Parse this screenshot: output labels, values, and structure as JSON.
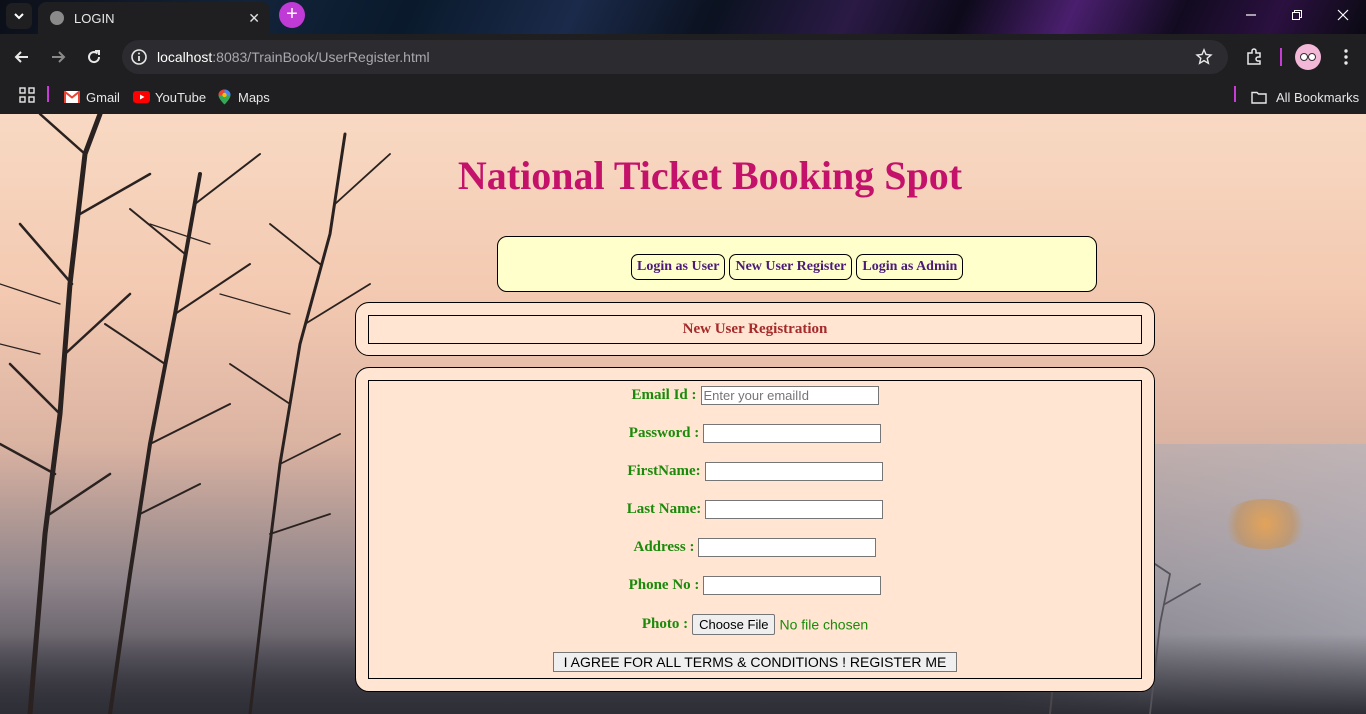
{
  "browser": {
    "tab_title": "LOGIN",
    "tab_close": "✕",
    "new_tab": "+",
    "url_host": "localhost",
    "url_path": ":8083/TrainBook/UserRegister.html",
    "bookmarks": [
      {
        "label": "Gmail"
      },
      {
        "label": "YouTube"
      },
      {
        "label": "Maps"
      }
    ],
    "all_bookmarks": "All Bookmarks",
    "accent_color": "#c73bd6"
  },
  "page": {
    "headline": "National Ticket Booking Spot",
    "nav": [
      "Login as User",
      "New User Register",
      "Login as Admin"
    ],
    "section_title": "New User Registration",
    "form": {
      "email_label": "Email Id :",
      "email_placeholder": "Enter your emailId",
      "password_label": "Password :",
      "firstname_label": "FirstName:",
      "lastname_label": "Last Name:",
      "address_label": "Address :",
      "phone_label": "Phone No :",
      "photo_label": "Photo :",
      "file_button": "Choose File",
      "file_status": "No file chosen",
      "submit_label": "I AGREE FOR ALL TERMS & CONDITIONS ! REGISTER ME"
    },
    "colors": {
      "headline": "#c4126b",
      "label": "#1a8a0a",
      "section_title": "#a52a2a",
      "nav_text": "#4b1a7a",
      "nav_bg": "#ffffcc",
      "panel_bg": "#ffe5d2"
    }
  }
}
